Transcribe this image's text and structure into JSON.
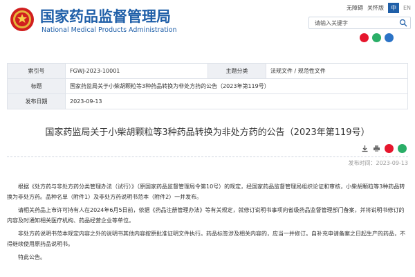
{
  "header": {
    "title_cn": "国家药品监督管理局",
    "title_en": "National Medical Products Administration",
    "links": [
      "无障碍",
      "关怀版"
    ],
    "lang_active": "中",
    "lang_other": "EN",
    "search_placeholder": "请输入关键字",
    "social_icons": [
      "weibo-icon",
      "wechat-icon",
      "app-icon"
    ],
    "brand_color": "#1f5fa8"
  },
  "info": {
    "index_label": "索引号",
    "index_value": "FGWJ-2023-10001",
    "category_label": "主题分类",
    "category_value": "法规文件 / 规范性文件",
    "title_label": "标题",
    "title_value": "国家药监局关于小柴胡颗粒等3种药品转换为非处方药的公告（2023年第119号）",
    "date_label": "发布日期",
    "date_value": "2023-09-13"
  },
  "article": {
    "title": "国家药监局关于小柴胡颗粒等3种药品转换为非处方药的公告（2023年第119号）",
    "meta": "发布时间：2023-09-13",
    "paragraphs": [
      "根据《处方药与非处方药分类管理办法（试行）》（原国家药品监督管理局令第10号）的规定，经国家药品监督管理局组织论证和审核，小柴胡颗粒等3种药品转换为非处方药。品种名单（附件1）及非处方药说明书范本（附件2）一并发布。",
      "请相关药品上市许可持有人在2024年6月5日前，依据《药品注册管理办法》等有关规定，就修订说明书事项向省级药品监督管理部门备案，并将说明书修订的内容及时通知相关医疗机构、药品经营企业等单位。",
      "非处方药说明书范本规定内容之外的说明书其他内容按原批准证明文件执行。药品标签涉及相关内容的，应当一并修订。自补充申请备案之日起生产的药品，不得继续使用原药品说明书。",
      "特此公告。"
    ]
  }
}
